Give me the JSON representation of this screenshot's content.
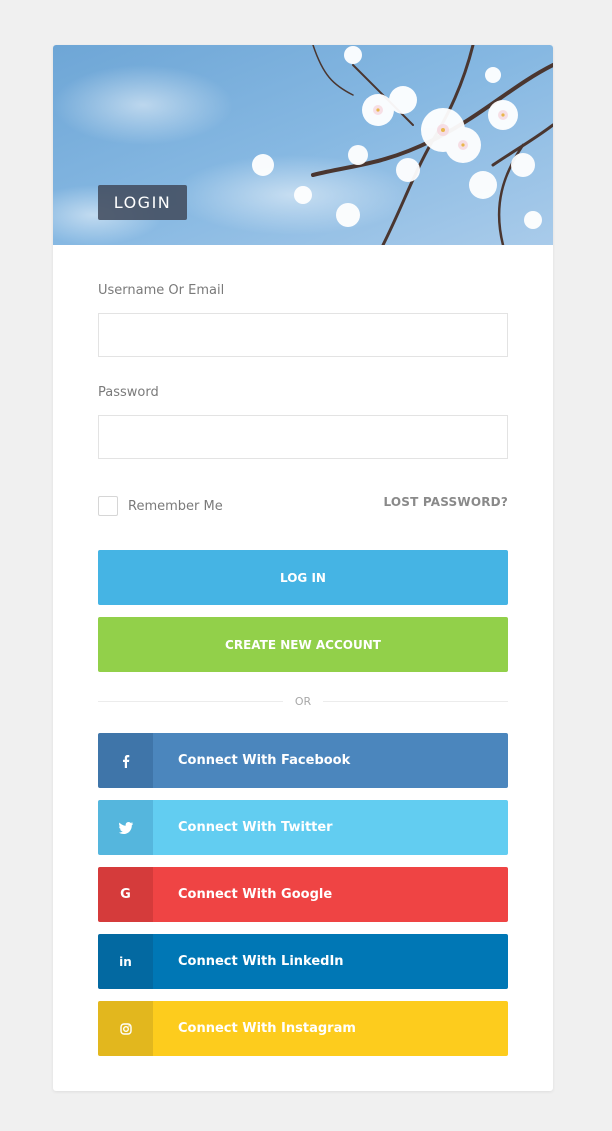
{
  "header": {
    "badge": "LOGIN"
  },
  "form": {
    "username_label": "Username Or Email",
    "username_value": "",
    "password_label": "Password",
    "password_value": "",
    "remember_label": "Remember Me",
    "remember_checked": false,
    "lost_password": "LOST PASSWORD?",
    "login_button": "LOG IN",
    "create_button": "CREATE NEW ACCOUNT",
    "or_text": "OR"
  },
  "social": [
    {
      "label": "Connect With Facebook",
      "icon": "facebook-icon",
      "color": "#4b86bd",
      "icon_color": "#3f75a9"
    },
    {
      "label": "Connect With Twitter",
      "icon": "twitter-icon",
      "color": "#62cdf1",
      "icon_color": "#55b6dd"
    },
    {
      "label": "Connect With Google",
      "icon": "google-icon",
      "color": "#ef4444",
      "icon_color": "#d53b3b"
    },
    {
      "label": "Connect With LinkedIn",
      "icon": "linkedin-icon",
      "color": "#0077b5",
      "icon_color": "#0369a1"
    },
    {
      "label": "Connect With Instagram",
      "icon": "instagram-icon",
      "color": "#fdcc1d",
      "icon_color": "#e2b71e"
    }
  ],
  "colors": {
    "login": "#45b4e4",
    "create": "#92d04a",
    "background": "#f0f0f0"
  }
}
